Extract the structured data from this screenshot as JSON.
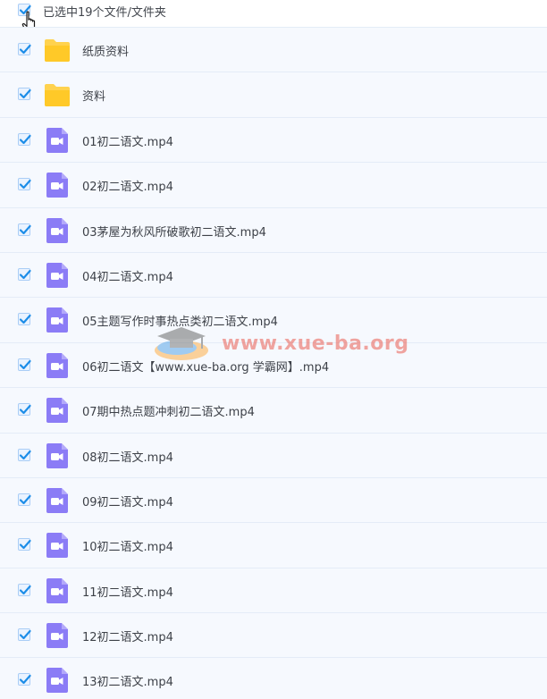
{
  "header": {
    "selection_text": "已选中19个文件/文件夹"
  },
  "files": [
    {
      "type": "folder",
      "name": "纸质资料"
    },
    {
      "type": "folder",
      "name": "资料"
    },
    {
      "type": "video",
      "name": "01初二语文.mp4"
    },
    {
      "type": "video",
      "name": "02初二语文.mp4"
    },
    {
      "type": "video",
      "name": "03茅屋为秋风所破歌初二语文.mp4"
    },
    {
      "type": "video",
      "name": "04初二语文.mp4"
    },
    {
      "type": "video",
      "name": "05主题写作时事热点类初二语文.mp4"
    },
    {
      "type": "video",
      "name": "06初二语文【www.xue-ba.org 学霸网】.mp4"
    },
    {
      "type": "video",
      "name": "07期中热点题冲刺初二语文.mp4"
    },
    {
      "type": "video",
      "name": "08初二语文.mp4"
    },
    {
      "type": "video",
      "name": "09初二语文.mp4"
    },
    {
      "type": "video",
      "name": "10初二语文.mp4"
    },
    {
      "type": "video",
      "name": "11初二语文.mp4"
    },
    {
      "type": "video",
      "name": "12初二语文.mp4"
    },
    {
      "type": "video",
      "name": "13初二语文.mp4"
    }
  ],
  "watermark": {
    "text": "www.xue-ba.org"
  },
  "colors": {
    "row_background": "#f6f9fe",
    "checkbox_check": "#1c8de8",
    "folder_yellow": "#ffd24e",
    "video_purple": "#8b7cf6"
  }
}
